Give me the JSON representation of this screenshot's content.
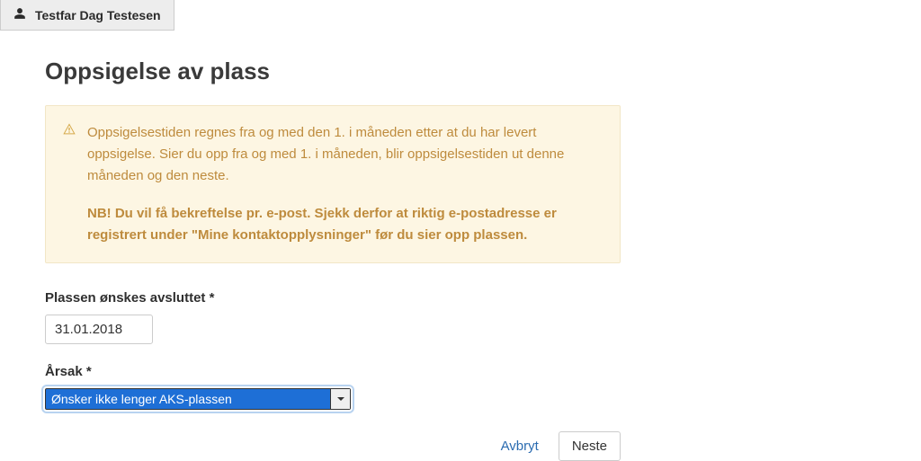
{
  "user_tab": {
    "name": "Testfar Dag Testesen"
  },
  "page": {
    "title": "Oppsigelse av plass"
  },
  "alert": {
    "p1": "Oppsigelsestiden regnes fra og med den 1. i måneden etter at du har levert oppsigelse. Sier du opp fra og med 1. i måneden, blir oppsigelsestiden ut denne måneden og den neste.",
    "p2": "NB! Du vil få bekreftelse pr. e-post. Sjekk derfor at riktig e-postadresse er registrert under \"Mine kontaktopplysninger\" før du sier opp plassen."
  },
  "form": {
    "date_label": "Plassen ønskes avsluttet *",
    "date_value": "31.01.2018",
    "reason_label": "Årsak *",
    "reason_value": "Ønsker ikke lenger AKS-plassen"
  },
  "actions": {
    "cancel": "Avbryt",
    "next": "Neste"
  }
}
